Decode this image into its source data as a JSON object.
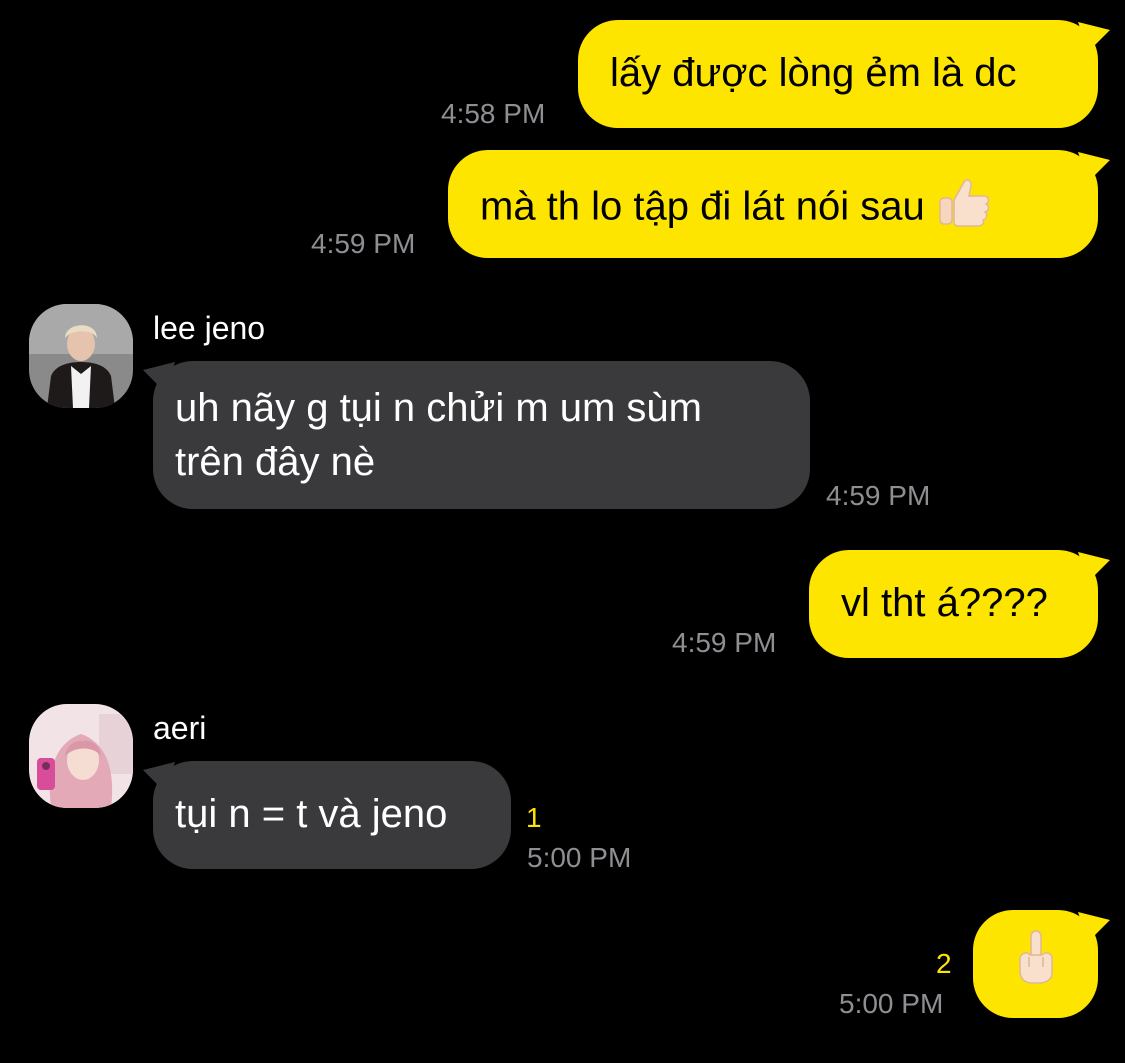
{
  "colors": {
    "background": "#000000",
    "my_bubble": "#fee500",
    "their_bubble": "#3a3a3c",
    "time_text": "#8e8e93",
    "unread_count": "#fee500"
  },
  "messages": [
    {
      "from": "me",
      "text": "lấy được lòng ẻm là dc",
      "time": "4:58 PM"
    },
    {
      "from": "me",
      "text": "mà th lo tập đi lát nói sau",
      "emoji": "thumbs-up-icon",
      "time": "4:59 PM"
    },
    {
      "from": "lee jeno",
      "sender": "lee jeno",
      "line1": "uh nãy g tụi n chửi m um sùm",
      "line2": "trên đây nè",
      "time": "4:59 PM"
    },
    {
      "from": "me",
      "text": "vl tht á????",
      "time": "4:59 PM"
    },
    {
      "from": "aeri",
      "sender": "aeri",
      "text": "tụi n = t và jeno",
      "unread": "1",
      "time": "5:00 PM"
    },
    {
      "from": "me",
      "emoji": "middle-finger-icon",
      "unread": "2",
      "time": "5:00 PM"
    }
  ]
}
